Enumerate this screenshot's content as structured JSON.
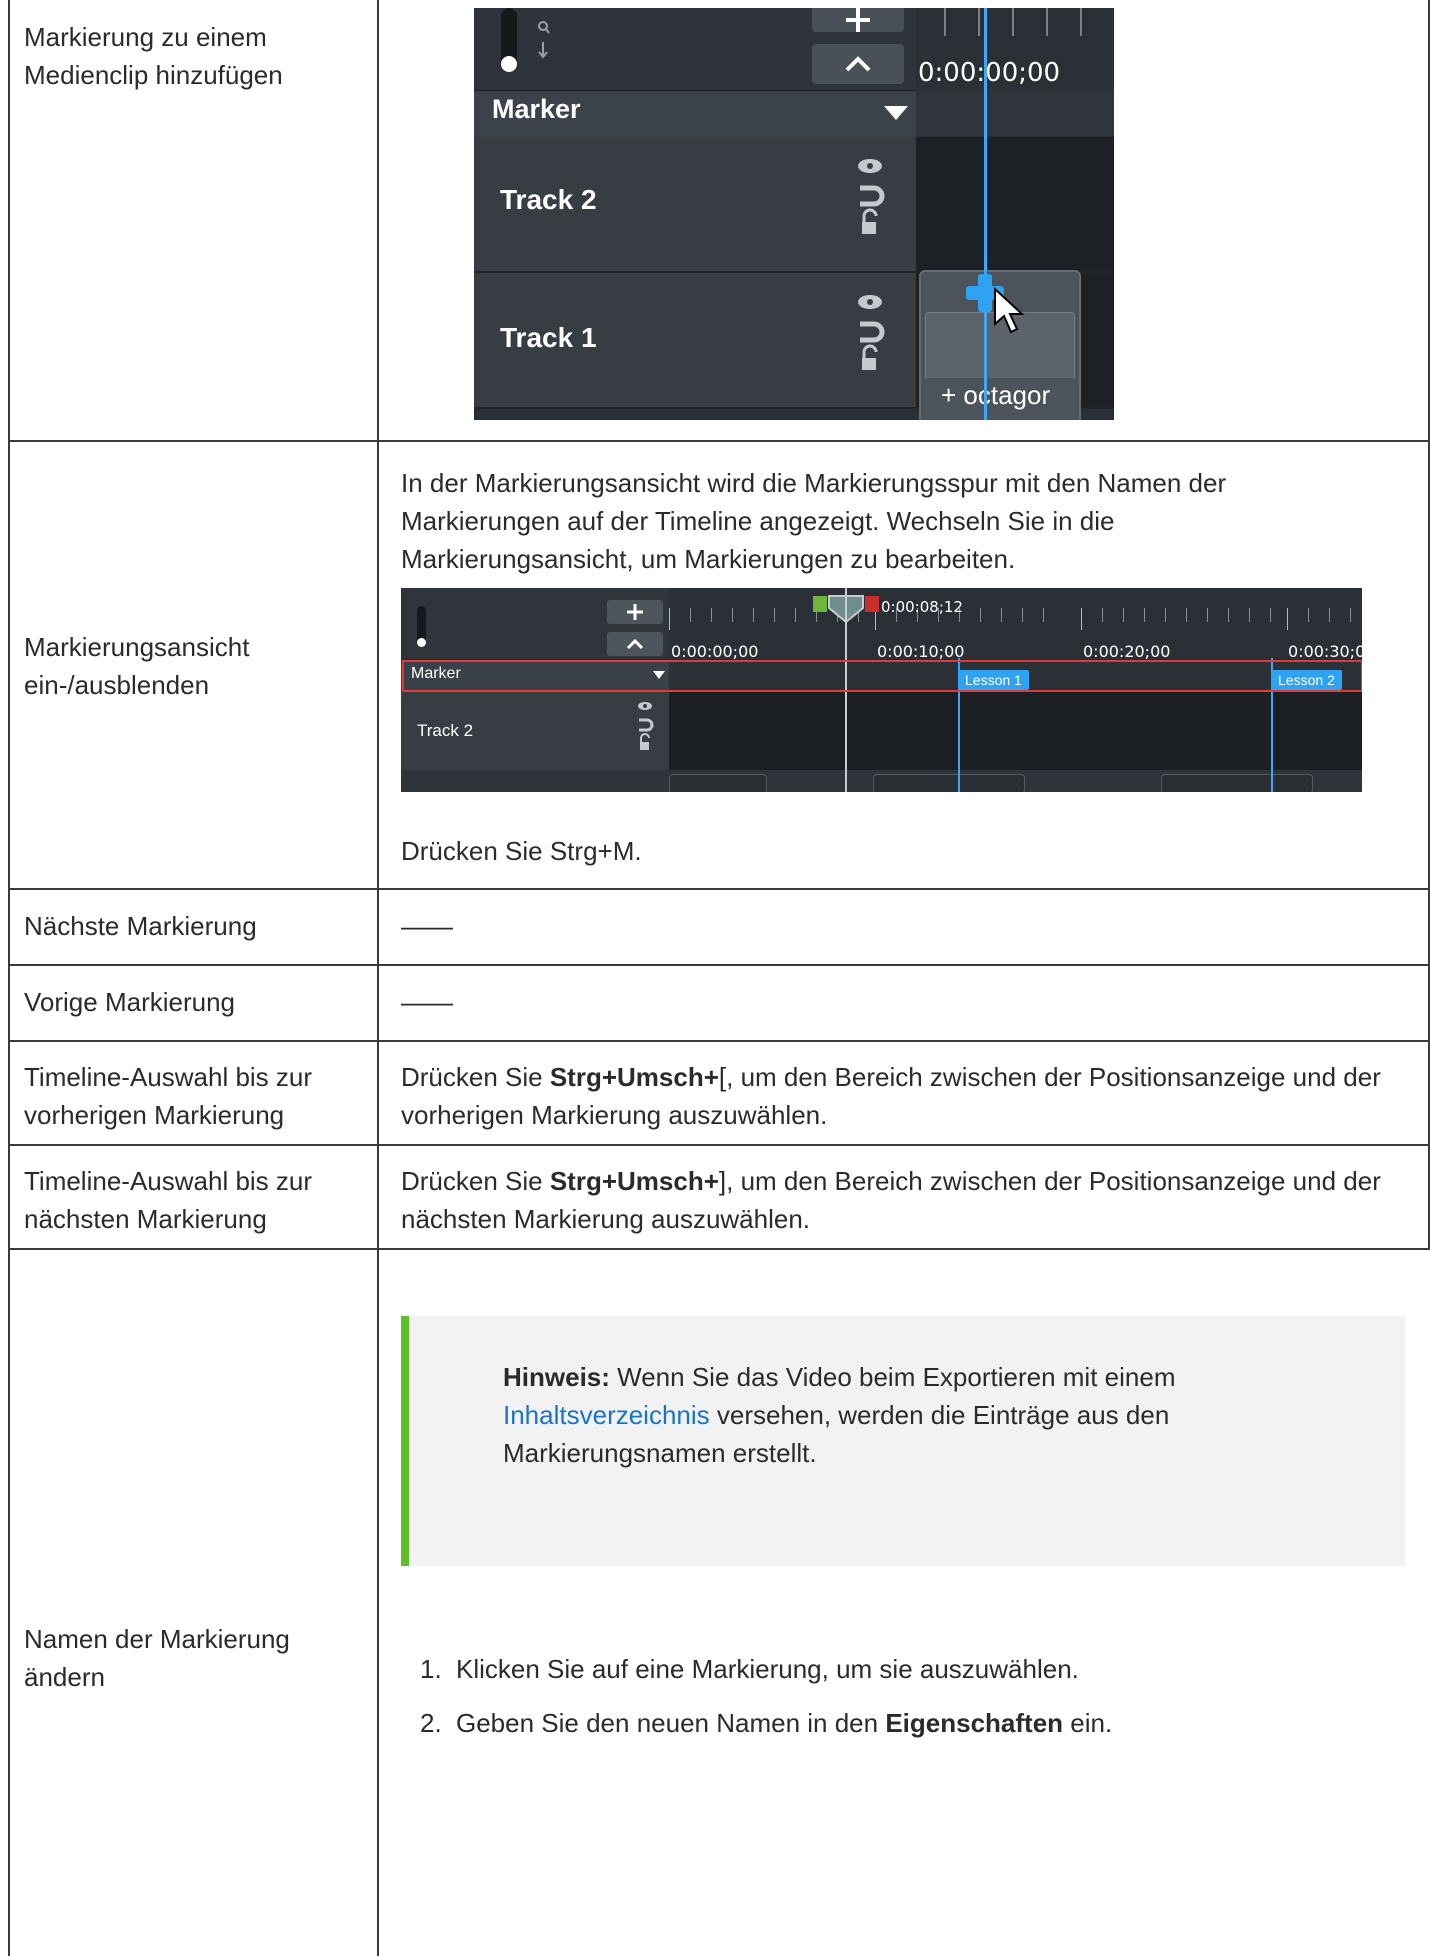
{
  "rows": [
    {
      "label": "Markierung zu einem Medienclip hinzufügen"
    },
    {
      "label": "Markierungsansicht ein-/ausblenden",
      "intro": "In der Markierungsansicht wird die Markierungsspur mit den Namen der Markierungen auf der Timeline angezeigt. Wechseln Sie in die Markierungsansicht, um Markierungen zu bearbeiten.",
      "shortcut_text": "Drücken Sie Strg+M."
    },
    {
      "label": "Nächste Markierung",
      "value": "——"
    },
    {
      "label": "Vorige Markierung",
      "value": "——"
    },
    {
      "label": "Timeline-Auswahl bis zur vorherigen Markierung",
      "pre": "Drücken Sie ",
      "keys": "Strg+Umsch+",
      "post": "[, um den Bereich zwischen der Positionsanzeige und der vorherigen Markierung auszuwählen."
    },
    {
      "label": "Timeline-Auswahl bis zur nächsten Markierung",
      "pre": "Drücken Sie ",
      "keys": "Strg+Umsch+",
      "post": "], um den Bereich zwischen der Positionsanzeige und der nächsten Markierung auszuwählen."
    },
    {
      "label": "Namen der Markierung ändern",
      "note_bold": "Hinweis:",
      "note_pre": " Wenn Sie das Video beim Exportieren mit einem ",
      "note_link": "Inhaltsverzeichnis",
      "note_post": " versehen, werden die Einträge aus den Markierungsnamen erstellt.",
      "steps": [
        {
          "num": "1.",
          "text": "Klicken Sie auf eine Markierung, um sie auszuwählen."
        },
        {
          "num": "2.",
          "pre": "Geben Sie den neuen Namen in den ",
          "bold": "Eigenschaften",
          "post": " ein."
        }
      ]
    }
  ],
  "screenshot1": {
    "time": "0:00:00;00",
    "marker_label": "Marker",
    "tracks": [
      "Track 2",
      "Track 1"
    ],
    "clip_label": "+ octagor"
  },
  "screenshot2": {
    "playhead_time": "0:00:08;12",
    "ticks": [
      "0:00:00;00",
      "0:00:10;00",
      "0:00:20;00",
      "0:00:30;0"
    ],
    "marker_label": "Marker",
    "track": "Track 2",
    "markers": [
      "Lesson 1",
      "Lesson 2"
    ]
  },
  "colors": {
    "note_accent": "#5fbf2a",
    "link": "#1a73c9",
    "highlight_box": "#e03a3a",
    "playhead": "#3ea6ff"
  }
}
